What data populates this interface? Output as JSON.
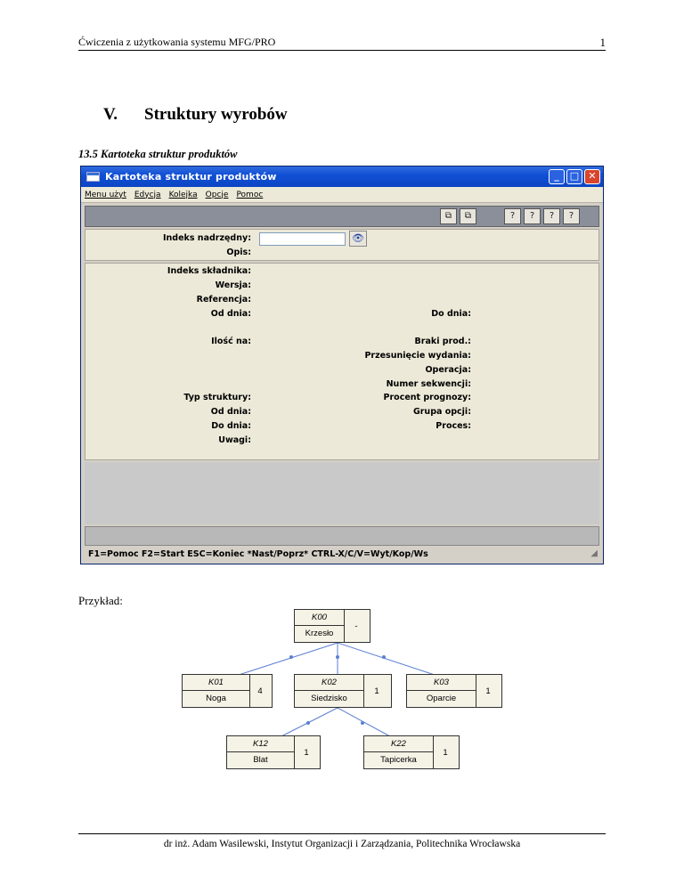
{
  "page": {
    "header_text": "Ćwiczenia z użytkowania systemu MFG/PRO",
    "page_number": "1",
    "section_number": "V.",
    "section_title": "Struktury wyrobów",
    "subsection_title": "13.5 Kartoteka struktur produktów",
    "example_label": "Przykład:",
    "footer_text": "dr inż. Adam Wasilewski, Instytut Organizacji i Zarządzania, Politechnika Wrocławska"
  },
  "window": {
    "title": "Kartoteka struktur produktów",
    "menu": [
      "Menu użyt",
      "Edycja",
      "Kolejka",
      "Opcje",
      "Pomoc"
    ],
    "toolbar_icons": [
      "copy-icon",
      "paste-icon",
      "help-search-icon",
      "help-icon",
      "help-pages-icon",
      "help-pointer-icon"
    ],
    "header_fields": {
      "parent_item_label": "Indeks nadrzędny:",
      "parent_item_value": "",
      "description_label": "Opis:"
    },
    "detail_fields_left": [
      "Indeks składnika:",
      "Wersja:",
      "Referencja:",
      "Od dnia:",
      "Ilość na:",
      "Typ struktury:",
      "Od dnia:",
      "Do dnia:",
      "Uwagi:"
    ],
    "detail_fields_right": [
      "Do dnia:",
      "Braki prod.:",
      "Przesunięcie wydania:",
      "Operacja:",
      "Numer sekwencji:",
      "Procent prognozy:",
      "Grupa opcji:",
      "Proces:"
    ],
    "status_text": "F1=Pomoc F2=Start ESC=Koniec *Nast/Poprz* CTRL-X/C/V=Wyt/Kop/Ws"
  },
  "tree": {
    "root": {
      "code": "K00",
      "name": "Krzesło",
      "qty": "-"
    },
    "level1": [
      {
        "code": "K01",
        "name": "Noga",
        "qty": "4"
      },
      {
        "code": "K02",
        "name": "Siedzisko",
        "qty": "1"
      },
      {
        "code": "K03",
        "name": "Oparcie",
        "qty": "1"
      }
    ],
    "level2": [
      {
        "code": "K12",
        "name": "Blat",
        "qty": "1"
      },
      {
        "code": "K22",
        "name": "Tapicerka",
        "qty": "1"
      }
    ],
    "line_color": "#5b7fd4"
  }
}
